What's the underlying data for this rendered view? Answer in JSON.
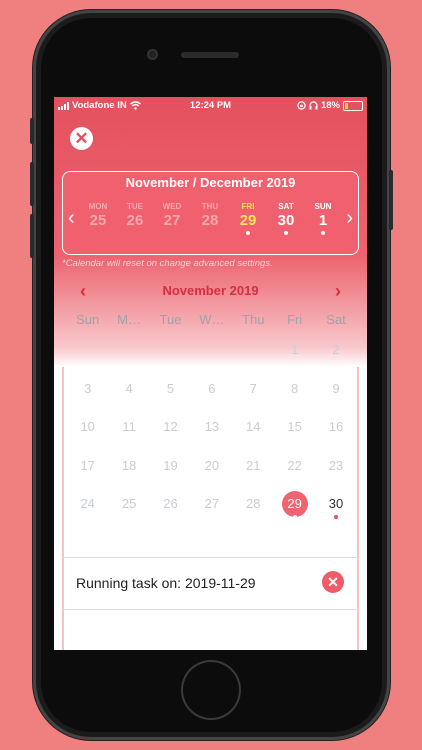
{
  "status_bar": {
    "carrier": "Vodafone IN",
    "time": "12:24 PM",
    "battery": "18%",
    "battery_level": 0.18,
    "icons": [
      "signal-icon",
      "wifi-icon",
      "lock-rotation-icon",
      "headphones-icon",
      "battery-icon"
    ]
  },
  "close_icon": "close-icon",
  "week_strip": {
    "title": "November / December 2019",
    "days": [
      {
        "name": "MON",
        "num": "25",
        "state": "faded",
        "dot": false
      },
      {
        "name": "TUE",
        "num": "26",
        "state": "faded",
        "dot": false
      },
      {
        "name": "WED",
        "num": "27",
        "state": "faded",
        "dot": false
      },
      {
        "name": "THU",
        "num": "28",
        "state": "faded",
        "dot": false
      },
      {
        "name": "FRI",
        "num": "29",
        "state": "active",
        "dot": true
      },
      {
        "name": "SAT",
        "num": "30",
        "state": "bright",
        "dot": true
      },
      {
        "name": "SUN",
        "num": "1",
        "state": "bright",
        "dot": true
      }
    ],
    "hint": "*Calendar will reset on change advanced settings."
  },
  "month_calendar": {
    "title": "November 2019",
    "weekdays": [
      "Sun",
      "M…",
      "Tue",
      "W…",
      "Thu",
      "Fri",
      "Sat"
    ],
    "weeks": [
      [
        "",
        "",
        "",
        "",
        "",
        "1",
        "2"
      ],
      [
        "3",
        "4",
        "5",
        "6",
        "7",
        "8",
        "9"
      ],
      [
        "10",
        "11",
        "12",
        "13",
        "14",
        "15",
        "16"
      ],
      [
        "17",
        "18",
        "19",
        "20",
        "21",
        "22",
        "23"
      ],
      [
        "24",
        "25",
        "26",
        "27",
        "28",
        "29",
        "30"
      ]
    ],
    "selected": "29",
    "marked": [
      "29",
      "30"
    ]
  },
  "task": {
    "text": "Running task on: 2019-11-29"
  },
  "colors": {
    "brand": "#E4505E",
    "accent_yellow": "#FFE45C",
    "month_title": "#D62E3E"
  }
}
